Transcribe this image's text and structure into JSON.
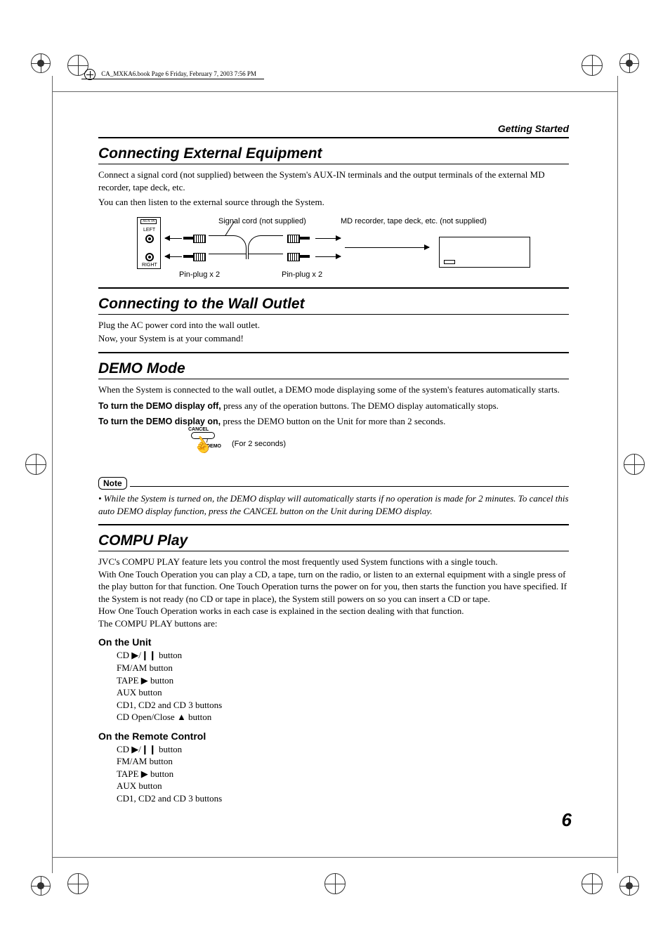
{
  "book_line": "CA_MXKA6.book  Page 6  Friday, February 7, 2003  7:56 PM",
  "header": "Getting Started",
  "page_number": "6",
  "s1": {
    "title": "Connecting External Equipment",
    "p1": "Connect a signal cord (not supplied) between the System's AUX-IN terminals and the output terminals of the external MD recorder, tape deck, etc.",
    "p2": "You can then listen to the external source through the System.",
    "diag": {
      "aux": "AUX IN",
      "left": "LEFT",
      "right": "RIGHT",
      "signal": "Signal cord (not supplied)",
      "md": "MD recorder, tape deck, etc. (not supplied)",
      "pin": "Pin-plug x 2"
    }
  },
  "s2": {
    "title": "Connecting to the Wall Outlet",
    "p1": "Plug the AC power cord into the wall outlet.",
    "p2": "Now, your System is at your command!"
  },
  "s3": {
    "title": "DEMO Mode",
    "p1": "When the System is connected to the wall outlet, a DEMO mode displaying some of the system's features automatically starts.",
    "off_label": "To turn the DEMO display off,",
    "off_text": " press any of the operation buttons. The DEMO display automatically stops.",
    "on_label": "To turn the DEMO display on,",
    "on_text": " press the DEMO button on the Unit for more than 2 seconds.",
    "cancel": "CANCEL",
    "demo": "/ DEMO",
    "for2": "(For 2 seconds)",
    "note_label": "Note",
    "note": "• While the System is turned on, the DEMO display will automatically starts if no operation is made for 2 minutes. To cancel this auto DEMO display function, press the CANCEL button on the Unit during DEMO display."
  },
  "s4": {
    "title": "COMPU Play",
    "p1": "JVC's COMPU PLAY feature lets you control the most frequently used System functions with a single touch.",
    "p2": "With One Touch Operation you can play a CD, a tape, turn on the radio, or listen to an external equipment with a single press of the play button for that function. One Touch Operation turns the power on for you, then starts the function you have specified. If the System is not ready (no CD or tape in place), the System still powers on so you can insert a CD or tape.",
    "p3": "How One Touch Operation works in each case is explained in the section dealing with that function.",
    "p4": "The COMPU PLAY buttons are:",
    "unit_head": "On the Unit",
    "unit_items": [
      "CD ▶/❙❙ button",
      "FM/AM button",
      "TAPE ▶ button",
      "AUX button",
      "CD1, CD2 and CD 3 buttons",
      "CD Open/Close ▲ button"
    ],
    "remote_head": "On the Remote Control",
    "remote_items": [
      "CD ▶/❙❙ button",
      "FM/AM button",
      "TAPE ▶ button",
      "AUX button",
      "CD1, CD2 and CD 3 buttons"
    ]
  }
}
